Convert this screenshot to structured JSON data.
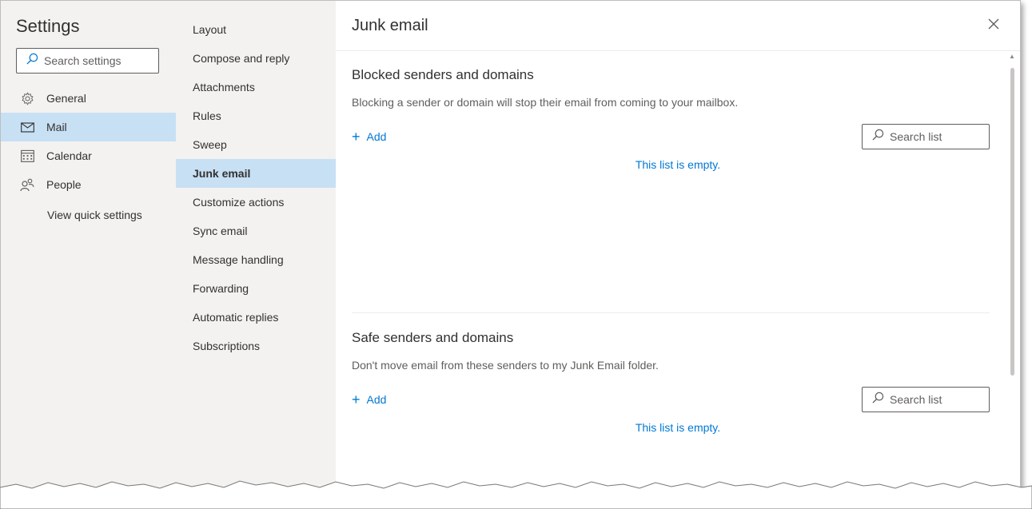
{
  "settings": {
    "title": "Settings",
    "search_placeholder": "Search settings"
  },
  "nav1": {
    "items": [
      {
        "label": "General",
        "icon": "gear-icon"
      },
      {
        "label": "Mail",
        "icon": "mail-icon",
        "selected": true
      },
      {
        "label": "Calendar",
        "icon": "calendar-icon"
      },
      {
        "label": "People",
        "icon": "people-icon"
      }
    ],
    "quick_settings": "View quick settings"
  },
  "nav2": {
    "items": [
      {
        "label": "Layout"
      },
      {
        "label": "Compose and reply"
      },
      {
        "label": "Attachments"
      },
      {
        "label": "Rules"
      },
      {
        "label": "Sweep"
      },
      {
        "label": "Junk email",
        "selected": true
      },
      {
        "label": "Customize actions"
      },
      {
        "label": "Sync email"
      },
      {
        "label": "Message handling"
      },
      {
        "label": "Forwarding"
      },
      {
        "label": "Automatic replies"
      },
      {
        "label": "Subscriptions"
      }
    ]
  },
  "content": {
    "title": "Junk email",
    "blocked": {
      "title": "Blocked senders and domains",
      "description": "Blocking a sender or domain will stop their email from coming to your mailbox.",
      "add_label": "Add",
      "search_placeholder": "Search list",
      "empty_message": "This list is empty."
    },
    "safe": {
      "title": "Safe senders and domains",
      "description": "Don't move email from these senders to my Junk Email folder.",
      "add_label": "Add",
      "search_placeholder": "Search list",
      "empty_message": "This list is empty."
    }
  },
  "colors": {
    "accent": "#0078d4",
    "selected_background": "#c7e0f4",
    "nav_background": "#f3f2f1"
  }
}
